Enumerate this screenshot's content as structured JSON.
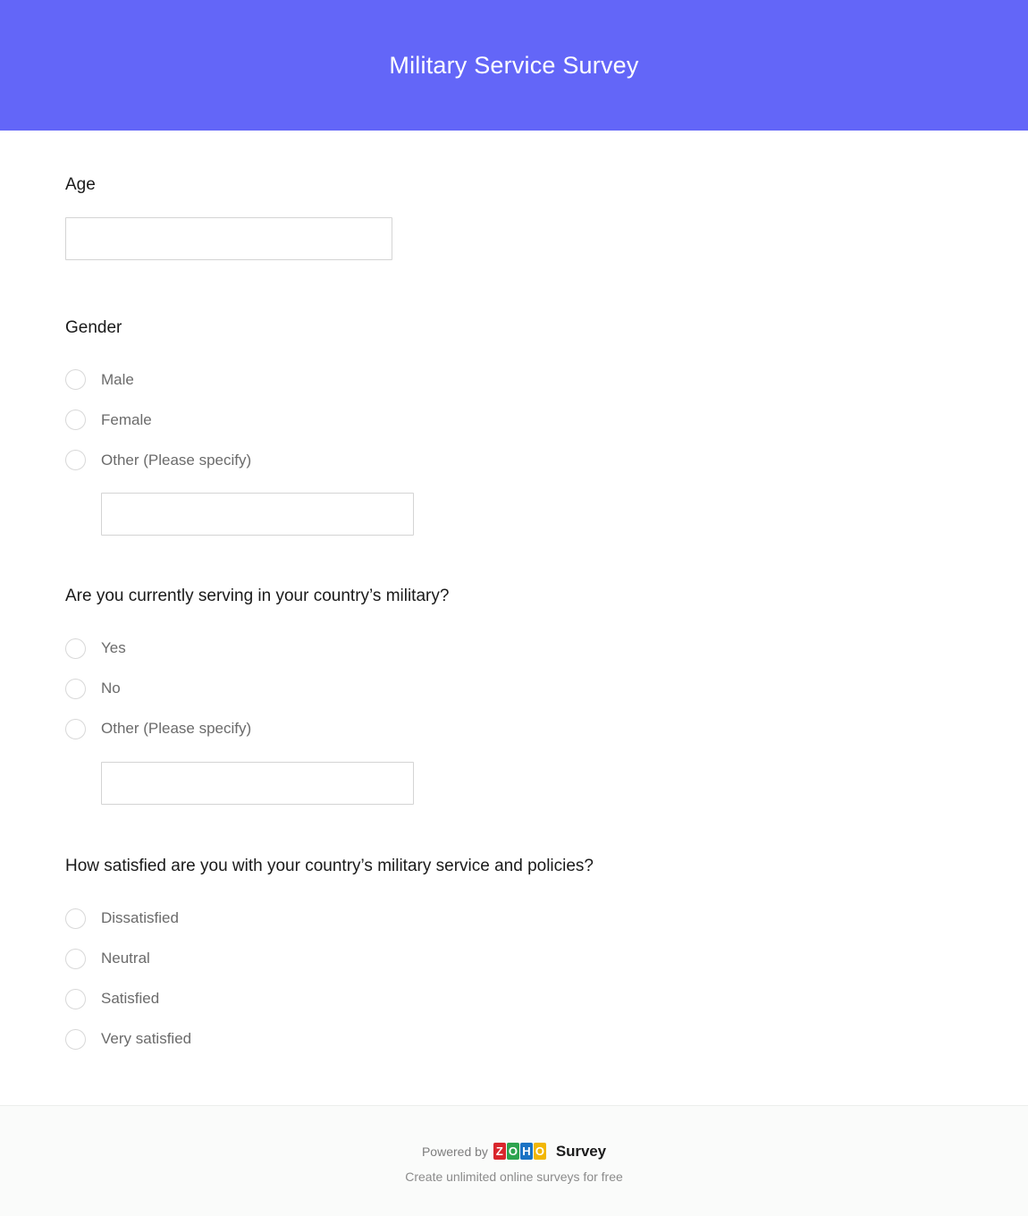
{
  "header": {
    "title": "Military Service Survey",
    "background_color": "#6366f8",
    "title_color": "#ffffff"
  },
  "questions": [
    {
      "id": "age",
      "label": "Age",
      "type": "text",
      "value": "",
      "placeholder": ""
    },
    {
      "id": "gender",
      "label": "Gender",
      "type": "radio",
      "options": [
        {
          "label": "Male",
          "selected": false
        },
        {
          "label": "Female",
          "selected": false
        },
        {
          "label": "Other (Please specify)",
          "selected": false
        }
      ],
      "other_input": {
        "value": "",
        "placeholder": ""
      }
    },
    {
      "id": "currently-serving",
      "label": "Are you currently serving in your country’s military?",
      "type": "radio",
      "options": [
        {
          "label": "Yes",
          "selected": false
        },
        {
          "label": "No",
          "selected": false
        },
        {
          "label": "Other (Please specify)",
          "selected": false
        }
      ],
      "other_input": {
        "value": "",
        "placeholder": ""
      }
    },
    {
      "id": "satisfaction",
      "label": "How satisfied are you with your country’s military service and policies?",
      "type": "radio",
      "options": [
        {
          "label": "Dissatisfied",
          "selected": false
        },
        {
          "label": "Neutral",
          "selected": false
        },
        {
          "label": "Satisfied",
          "selected": false
        },
        {
          "label": "Very satisfied",
          "selected": false
        }
      ]
    }
  ],
  "footer": {
    "powered_by": "Powered by",
    "brand_word": "Survey",
    "tagline": "Create unlimited online surveys for free",
    "logo_tiles": [
      {
        "letter": "Z",
        "color": "#d9262c"
      },
      {
        "letter": "O",
        "color": "#2da44e"
      },
      {
        "letter": "H",
        "color": "#1a73c4"
      },
      {
        "letter": "O",
        "color": "#f2b705"
      }
    ],
    "background_color": "#fafbfa"
  }
}
